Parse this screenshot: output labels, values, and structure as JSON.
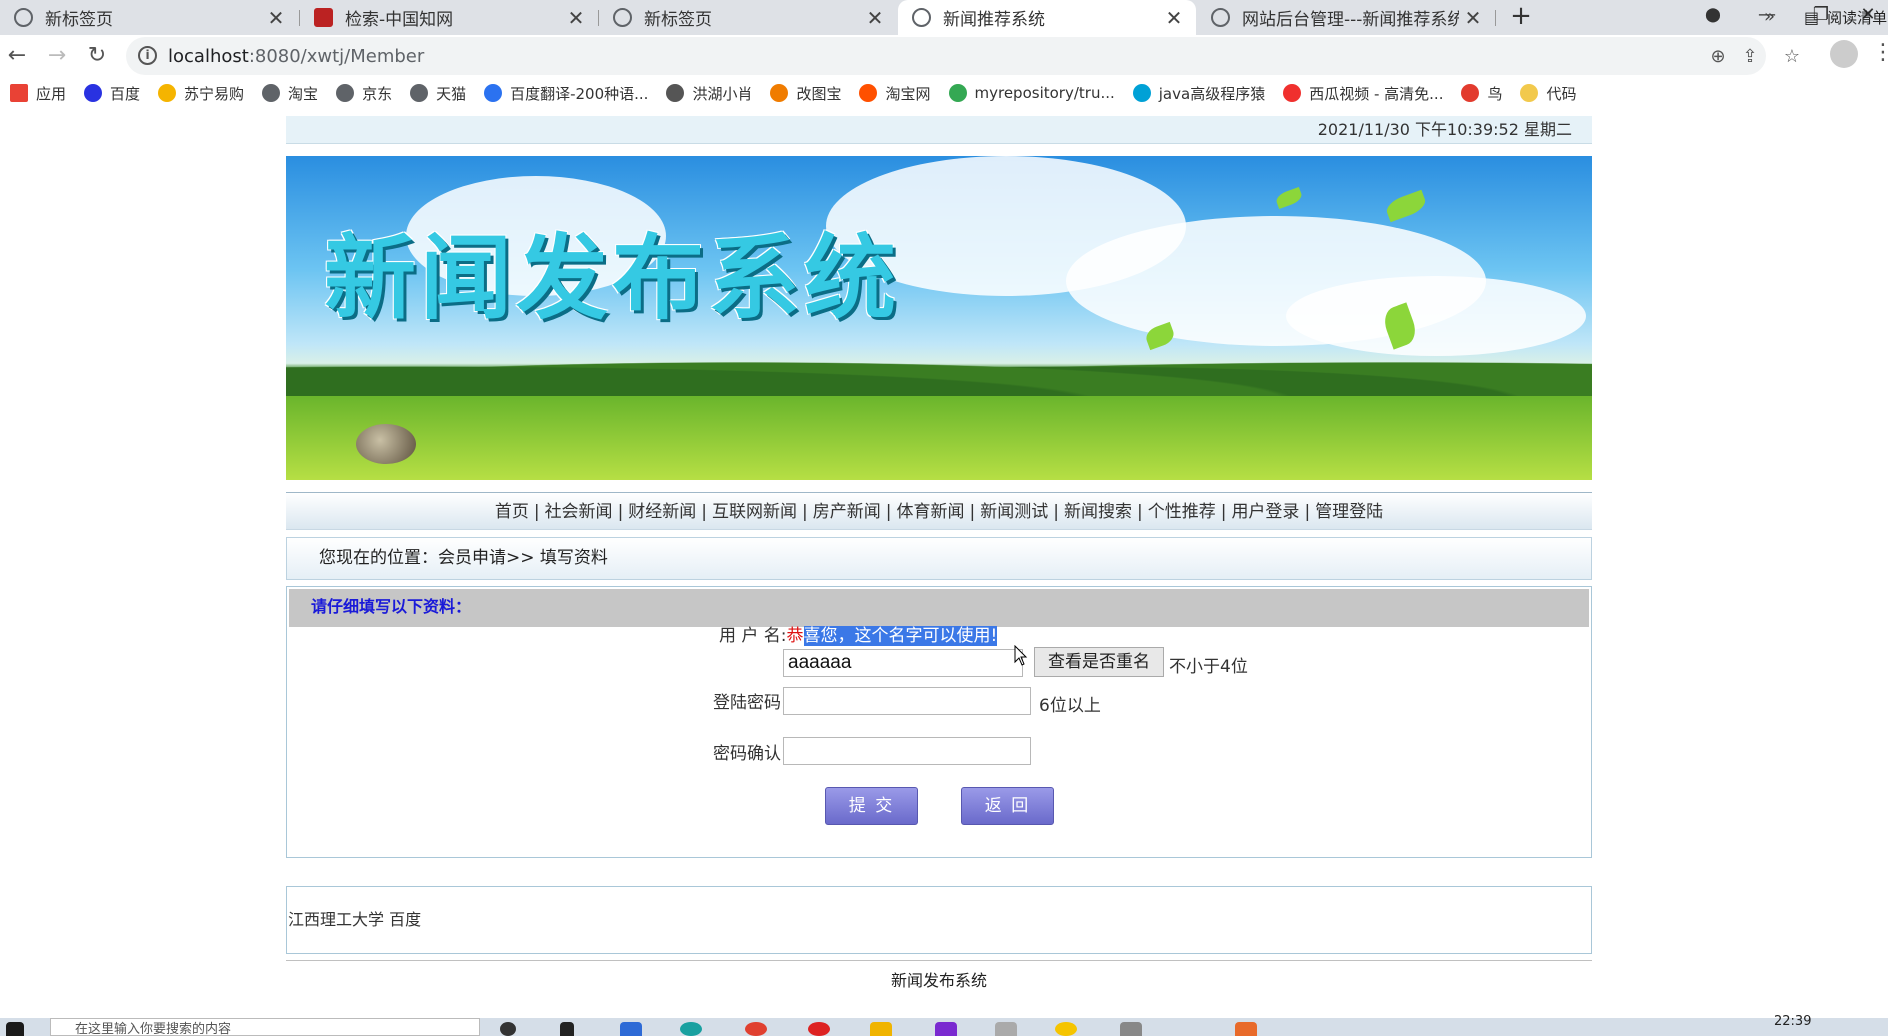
{
  "browser": {
    "tabs": [
      {
        "title": "新标签页",
        "active": false
      },
      {
        "title": "检索-中国知网",
        "active": false
      },
      {
        "title": "新标签页",
        "active": false
      },
      {
        "title": "新闻推荐系统",
        "active": true
      },
      {
        "title": "网站后台管理---新闻推荐系统",
        "active": false
      }
    ],
    "url_host": "localhost",
    "url_path": ":8080/xwtj/Member",
    "bookmarks": [
      {
        "label": "应用",
        "icon": "apps-grid-icon",
        "color": "#e94235"
      },
      {
        "label": "百度",
        "icon": "baidu-paw-icon",
        "color": "#2932e1"
      },
      {
        "label": "苏宁易购",
        "icon": "suning-icon",
        "color": "#f5b400"
      },
      {
        "label": "淘宝",
        "icon": "globe-icon",
        "color": "#5f6368"
      },
      {
        "label": "京东",
        "icon": "globe-icon",
        "color": "#5f6368"
      },
      {
        "label": "天猫",
        "icon": "globe-icon",
        "color": "#5f6368"
      },
      {
        "label": "百度翻译-200种语...",
        "icon": "translate-icon",
        "color": "#2b72f0"
      },
      {
        "label": "洪湖小肖",
        "icon": "bird-icon",
        "color": "#555555"
      },
      {
        "label": "改图宝",
        "icon": "gaitubao-icon",
        "color": "#f07c00"
      },
      {
        "label": "淘宝网",
        "icon": "taobao-icon",
        "color": "#ff5000"
      },
      {
        "label": "myrepository/tru...",
        "icon": "chrome-icon",
        "color": "#34a853"
      },
      {
        "label": "java高级程序猿",
        "icon": "bilibili-icon",
        "color": "#00a1d6"
      },
      {
        "label": "西瓜视频 - 高清免...",
        "icon": "xigua-icon",
        "color": "#f0302e"
      },
      {
        "label": "鸟",
        "icon": "bird-red-icon",
        "color": "#e23b2e"
      },
      {
        "label": "代码",
        "icon": "moon-icon",
        "color": "#f2c94c"
      }
    ],
    "reading_list": "阅读清单"
  },
  "page": {
    "datetime": "2021/11/30 下午10:39:52  星期二",
    "banner_title": "新闻发布系统",
    "nav": [
      "首页",
      "社会新闻",
      "财经新闻",
      "互联网新闻",
      "房产新闻",
      "体育新闻",
      "新闻测试",
      "新闻搜索",
      "个性推荐",
      "用户登录",
      "管理登陆"
    ],
    "location": "您现在的位置：会员申请>> 填写资料",
    "form": {
      "heading": "请仔细填写以下资料：",
      "username_label": "用 户 名:",
      "username_msg_red": "恭",
      "username_msg_hl": "喜您，这个名字可以使用! ",
      "username_value": "aaaaaa",
      "check_button": "查看是否重名",
      "username_hint": "不小于4位",
      "password_label": "登陆密码:",
      "password_hint": "6位以上",
      "confirm_label": "密码确认:",
      "submit": "提 交",
      "back": "返 回"
    },
    "footer_links": "江西理工大学 百度",
    "footer_title": "新闻发布系统"
  },
  "taskbar": {
    "search_placeholder": "在这里输入你要搜索的内容",
    "clock": "22:39"
  },
  "colors": {
    "form_heading": "#1a1ad8",
    "highlight": "#3b78e7",
    "button": "#7070d0"
  }
}
